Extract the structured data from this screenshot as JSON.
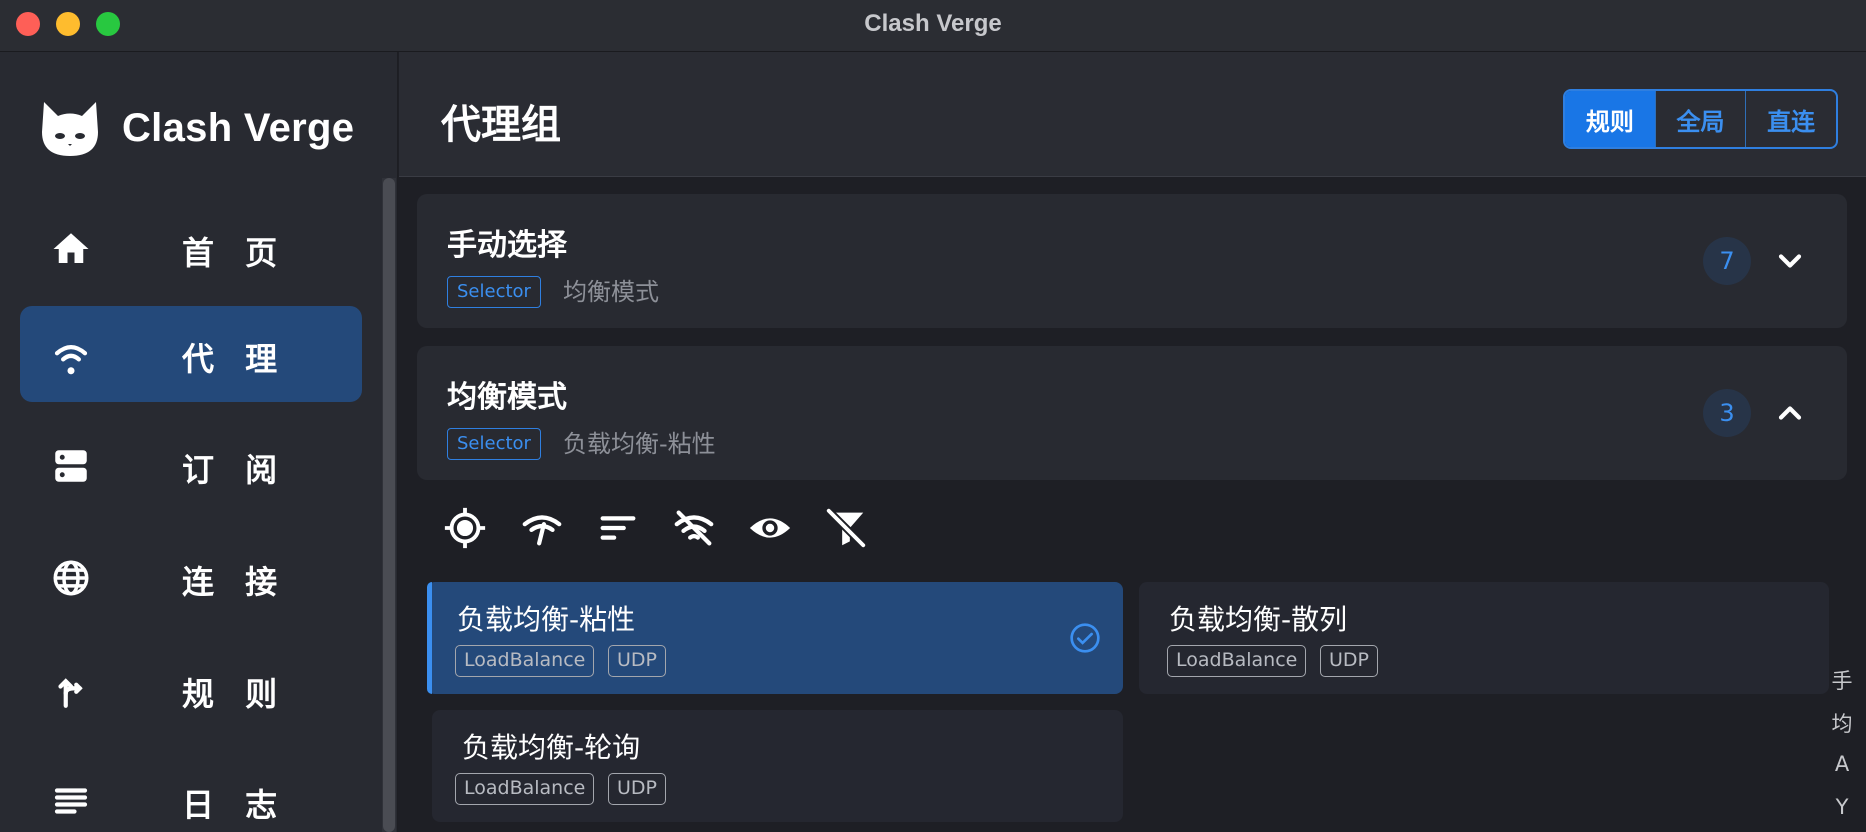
{
  "window": {
    "title": "Clash Verge"
  },
  "brand": {
    "name": "Clash Verge"
  },
  "sidebar": {
    "items": [
      {
        "label": "首 页",
        "icon": "home-icon",
        "active": false
      },
      {
        "label": "代 理",
        "icon": "wifi-icon",
        "active": true
      },
      {
        "label": "订 阅",
        "icon": "dns-icon",
        "active": false
      },
      {
        "label": "连 接",
        "icon": "globe-icon",
        "active": false
      },
      {
        "label": "规 则",
        "icon": "fork-icon",
        "active": false
      },
      {
        "label": "日 志",
        "icon": "list-icon",
        "active": false
      }
    ]
  },
  "header": {
    "title": "代理组",
    "modes": [
      {
        "label": "规则",
        "active": true
      },
      {
        "label": "全局",
        "active": false
      },
      {
        "label": "直连",
        "active": false
      }
    ]
  },
  "groups": [
    {
      "name": "手动选择",
      "type": "Selector",
      "now": "均衡模式",
      "count": "7",
      "expanded": false
    },
    {
      "name": "均衡模式",
      "type": "Selector",
      "now": "负载均衡-粘性",
      "count": "3",
      "expanded": true
    }
  ],
  "toolbar": {
    "icons": [
      "target-icon",
      "wifi-check-icon",
      "sort-icon",
      "wifi-off-icon",
      "eye-icon",
      "filter-off-icon"
    ]
  },
  "proxies": [
    {
      "name": "负载均衡-粘性",
      "tags": [
        "LoadBalance",
        "UDP"
      ],
      "selected": true
    },
    {
      "name": "负载均衡-散列",
      "tags": [
        "LoadBalance",
        "UDP"
      ],
      "selected": false
    },
    {
      "name": "负载均衡-轮询",
      "tags": [
        "LoadBalance",
        "UDP"
      ],
      "selected": false
    }
  ],
  "index_bar": [
    "手",
    "均",
    "A",
    "Y"
  ],
  "colors": {
    "accent": "#1976e6",
    "active_nav": "#24497a",
    "background": "#1e1f25"
  }
}
